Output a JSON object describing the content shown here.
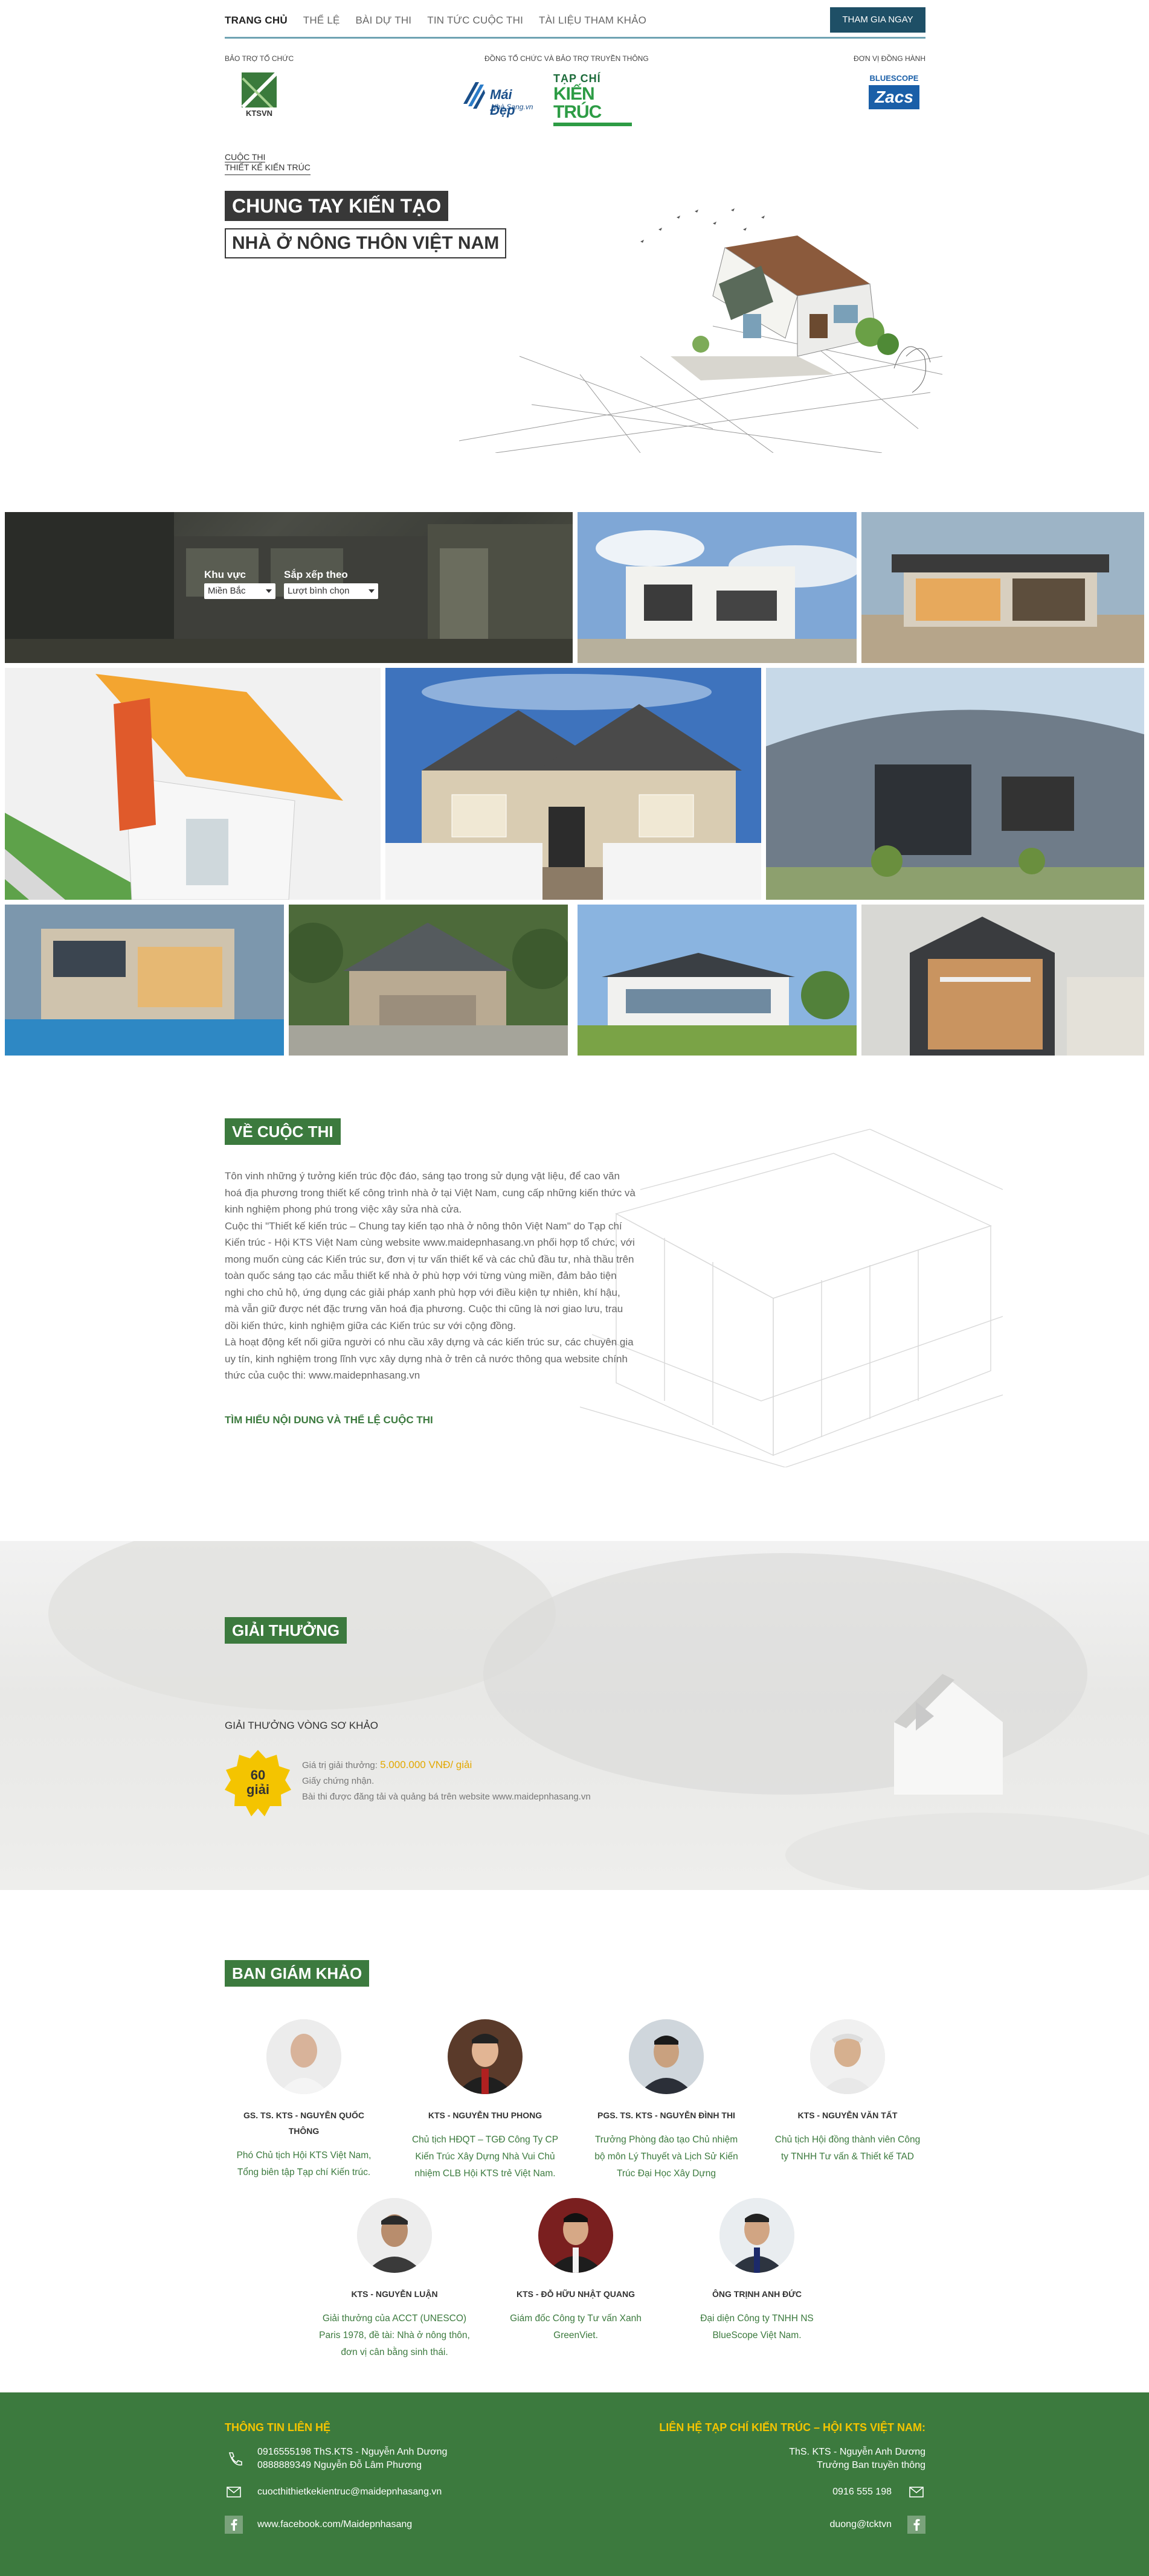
{
  "nav": {
    "items": [
      "TRANG CHỦ",
      "THỂ LỆ",
      "BÀI DỰ THI",
      "TIN TỨC CUỘC THI",
      "TÀI LIỆU THAM KHẢO"
    ],
    "join_button": "THAM GIA NGAY"
  },
  "sponsors": {
    "left_label": "BẢO TRỢ TỔ CHỨC",
    "center_label": "ĐỒNG TỔ CHỨC VÀ BẢO TRỢ TRUYỀN THÔNG",
    "right_label": "ĐƠN VỊ ĐỒNG HÀNH",
    "ktsvn": "KTSVN",
    "maidep_1": "Mái Đẹp",
    "maidep_2": "Nhà Sang.vn",
    "kientruc_1": "TẠP CHÍ",
    "kientruc_2": "KIẾN TRÚC",
    "bluescope_1": "BLUESCOPE",
    "bluescope_2": "Zacs"
  },
  "hero": {
    "subtitle_1": "CUỘC THI",
    "subtitle_2": "THIẾT KẾ KIẾN TRÚC",
    "title_1": "CHUNG TAY KIẾN TẠO",
    "title_2": "NHÀ Ở NÔNG THÔN VIỆT NAM"
  },
  "filter": {
    "region_label": "Khu vực",
    "region_value": "Miền Bắc",
    "sort_label": "Sắp xếp theo",
    "sort_value": "Lượt bình chọn"
  },
  "about": {
    "title": "VỀ CUỘC THI",
    "p1": "Tôn vinh những ý tưởng kiến trúc độc đáo, sáng tạo trong sử dụng vật liệu, để cao văn hoá địa phương trong thiết kế công trình nhà ở tại Việt Nam, cung cấp những kiến thức và kinh nghiệm phong phú trong việc xây sửa nhà cửa.",
    "p2": "Cuộc thi \"Thiết kế kiến trúc – Chung tay kiến tạo nhà ở nông thôn Việt Nam\" do Tạp chí Kiến trúc - Hội KTS Việt Nam cùng website www.maidepnhasang.vn phối hợp tổ chức, với mong muốn cùng các Kiến trúc sư, đơn vị tư vấn thiết kế và các chủ đầu tư, nhà thầu trên toàn quốc sáng tạo các mẫu thiết kế nhà ở phù hợp với từng vùng miền, đảm bảo tiện nghi cho chủ hộ, ứng dụng các giải pháp xanh phù hợp với điều kiện tự nhiên, khí hậu, mà vẫn giữ được nét đặc trưng văn hoá địa phương. Cuộc thi cũng là nơi giao lưu, trau dồi kiến thức, kinh nghiệm giữa các Kiến trúc sư với cộng đồng.",
    "p3": "Là hoạt động kết nối giữa người có nhu cầu xây dựng và các kiến trúc sư, các chuyên gia uy tín, kinh nghiệm trong lĩnh vực xây dựng nhà ở trên cả nước thông qua website chính thức của cuộc thi: www.maidepnhasang.vn",
    "link": "TÌM HIỂU NỘI DUNG VÀ THỂ LỆ CUỘC THI"
  },
  "awards": {
    "title": "GIẢI THƯỞNG",
    "round": "GIẢI THƯỞNG VÒNG SƠ KHẢO",
    "badge_count": "60",
    "badge_unit": "giải",
    "value_prefix": "Giá trị giải thưởng: ",
    "value_amount": "5.000.000 VNĐ/ giải",
    "line2": "Giấy chứng nhận.",
    "line3": "Bài thi được đăng tải và quảng bá trên website www.maidepnhasang.vn"
  },
  "judges": {
    "title": "BAN GIÁM KHẢO",
    "list": [
      {
        "name": "GS. TS. KTS - NGUYỄN QUỐC THÔNG",
        "desc": "Phó Chủ tịch Hội KTS Việt Nam, Tổng biên tập Tạp chí Kiến trúc."
      },
      {
        "name": "KTS - NGUYỄN THU PHONG",
        "desc": "Chủ tịch HĐQT – TGĐ Công Ty CP Kiến Trúc Xây Dựng Nhà Vui Chủ nhiệm CLB Hội KTS trẻ Việt Nam."
      },
      {
        "name": "PGS. TS. KTS - NGUYỄN ĐÌNH THI",
        "desc": "Trưởng Phòng đào tạo Chủ nhiệm bộ môn Lý Thuyết và Lịch Sử Kiến Trúc Đại Học Xây Dựng"
      },
      {
        "name": "KTS - NGUYỄN VĂN TẤT",
        "desc": "Chủ tịch Hội đồng thành viên Công ty TNHH Tư vấn & Thiết kế TAD"
      },
      {
        "name": "KTS - NGUYỄN LUẬN",
        "desc": "Giải thưởng của ACCT (UNESCO) Paris 1978, đề tài: Nhà ở nông thôn, đơn vị cân bằng sinh thái."
      },
      {
        "name": "KTS - ĐỖ HỮU NHẬT QUANG",
        "desc": "Giám đốc Công ty Tư vấn Xanh GreenViet."
      },
      {
        "name": "ÔNG TRỊNH ANH ĐỨC",
        "desc": "Đại diện Công ty TNHH NS BlueScope Việt Nam."
      }
    ]
  },
  "footer": {
    "left_title": "THÔNG TIN LIÊN HỆ",
    "phone_1": "0916555198 ThS.KTS - Nguyễn Anh Dương",
    "phone_2": "0888889349 Nguyễn Đỗ Lâm Phương",
    "email": "cuocthithietkekientruc@maidepnhasang.vn",
    "facebook": "www.facebook.com/Maidepnhasang",
    "right_title": "LIÊN HỆ TẠP CHÍ KIẾN TRÚC – HỘI KTS VIỆT NAM:",
    "right_person_1": "ThS. KTS - Nguyễn Anh Dương",
    "right_person_2": "Trưởng Ban truyền thông",
    "right_phone": "0916 555 198",
    "right_email": "duong@tcktvn"
  },
  "colors": {
    "green": "#3c7a3e",
    "dark_blue": "#1e4f66",
    "gold": "#f4c400"
  }
}
